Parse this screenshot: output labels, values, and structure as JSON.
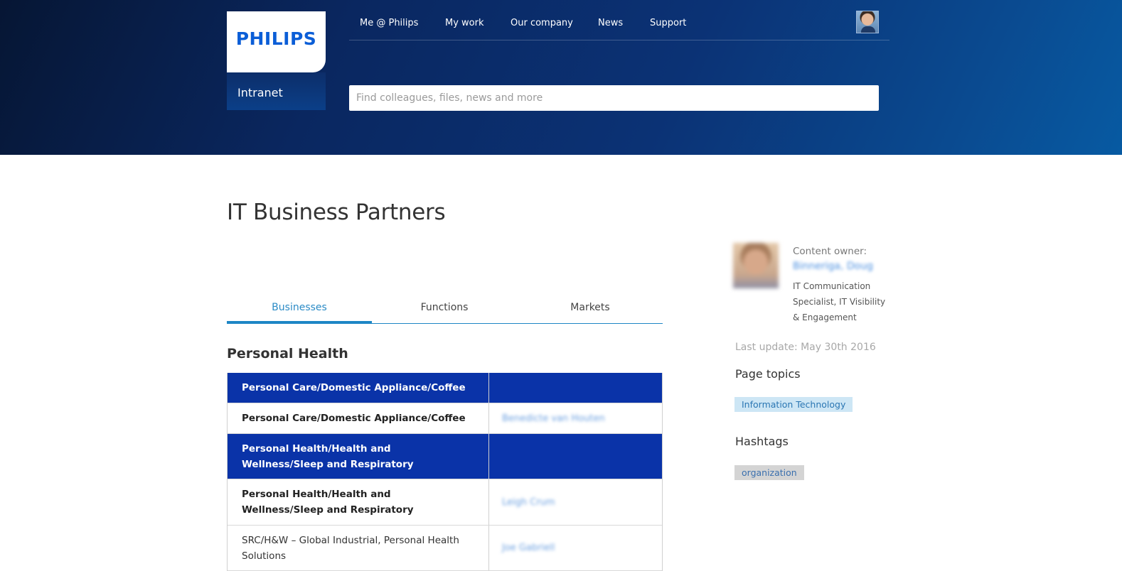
{
  "brand": {
    "logo_text": "PHILIPS",
    "sub_label": "Intranet"
  },
  "nav": {
    "items": [
      "Me @ Philips",
      "My work",
      "Our company",
      "News",
      "Support"
    ]
  },
  "search": {
    "placeholder": "Find colleagues, files, news and more",
    "value": ""
  },
  "page": {
    "title": "IT Business Partners"
  },
  "tabs": [
    {
      "label": "Businesses",
      "active": true
    },
    {
      "label": "Functions",
      "active": false
    },
    {
      "label": "Markets",
      "active": false
    }
  ],
  "section": {
    "title": "Personal Health"
  },
  "table": {
    "rows": [
      {
        "type": "head",
        "name": "Personal Care/Domestic Appliance/Coffee",
        "contact": ""
      },
      {
        "type": "sub",
        "name": "Personal Care/Domestic Appliance/Coffee",
        "contact": "Benedicte van Houten"
      },
      {
        "type": "head",
        "name": "Personal Health/Health and Wellness/Sleep and Respiratory",
        "contact": ""
      },
      {
        "type": "sub",
        "name": "Personal Health/Health and Wellness/Sleep and Respiratory",
        "contact": "Leigh Crum"
      },
      {
        "type": "plain",
        "name": "SRC/H&W – Global Industrial, Personal Health Solutions",
        "contact": "Joe Gabriell"
      }
    ]
  },
  "sidebar": {
    "owner_label": "Content owner:",
    "owner_name": "Binneriga, Doug",
    "owner_role": "IT Communication Specialist, IT Visibility & Engagement",
    "last_update": "Last update: May 30th 2016",
    "topics_heading": "Page topics",
    "topic_tag": "Information Technology",
    "hashtags_heading": "Hashtags",
    "hashtag": "organization"
  },
  "colors": {
    "header_gradient_start": "#061634",
    "header_gradient_end": "#075aa2",
    "table_head": "#0a33a8",
    "tab_active": "#1d86c5",
    "brand_blue": "#0b5ed7"
  }
}
